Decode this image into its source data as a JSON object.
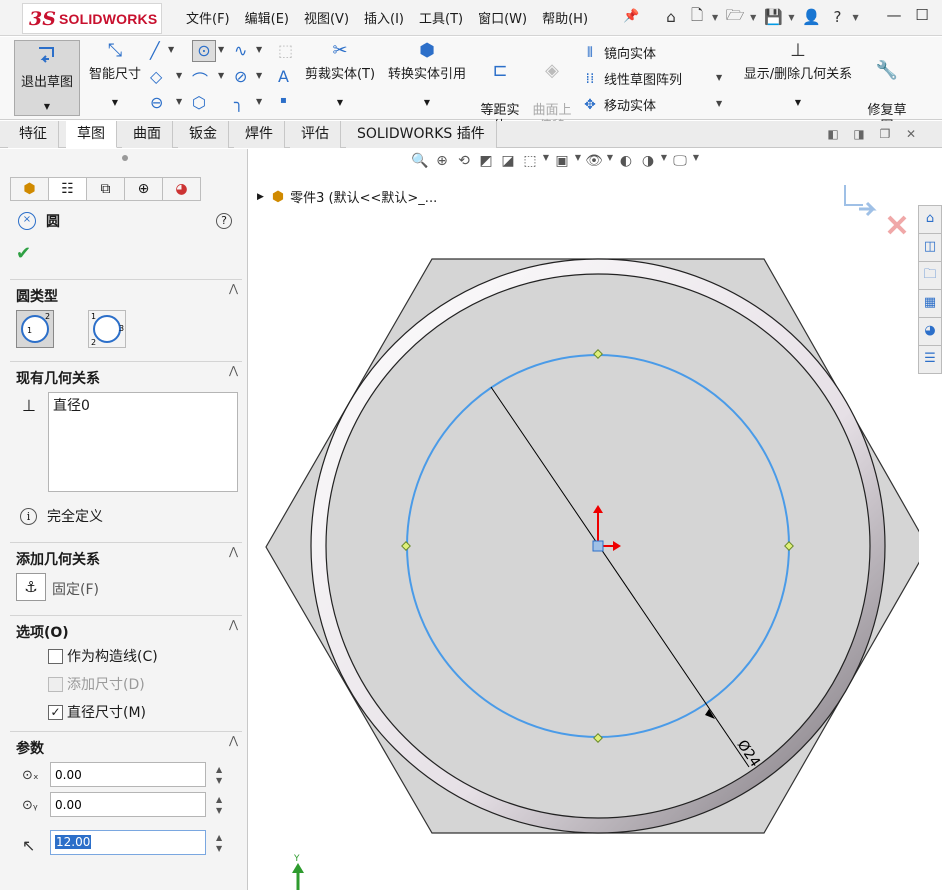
{
  "app": {
    "logo_ds": "3S",
    "logo_text": "SOLIDWORKS"
  },
  "menu": [
    "文件(F)",
    "编辑(E)",
    "视图(V)",
    "插入(I)",
    "工具(T)",
    "窗口(W)",
    "帮助(H)"
  ],
  "ribbon": {
    "exit_sketch": "退出草图",
    "smart_dimension": "智能尺寸",
    "trim": "剪裁实体(T)",
    "convert": "转换实体引用",
    "offset": "等距实\n体",
    "offset_surface": "曲面上\n偏移",
    "mirror": "镜向实体",
    "linear_pattern": "线性草图阵列",
    "move": "移动实体",
    "display_relations": "显示/删除几何关系",
    "repair": "修复草\n图"
  },
  "tabs": [
    "特征",
    "草图",
    "曲面",
    "钣金",
    "焊件",
    "评估",
    "SOLIDWORKS 插件"
  ],
  "active_tab": "草图",
  "property_manager": {
    "title": "圆",
    "circle_type_label": "圆类型",
    "existing_relations_label": "现有几何关系",
    "relation_item": "直径0",
    "fully_defined": "完全定义",
    "add_relations_label": "添加几何关系",
    "fix_label": "固定(F)",
    "options_label": "选项(O)",
    "construction": "作为构造线(C)",
    "add_dimension": "添加尺寸(D)",
    "diameter_dimension": "直径尺寸(M)",
    "parameters_label": "参数",
    "cx": "0.00",
    "cy": "0.00",
    "radius": "12.00"
  },
  "tree": {
    "part": "零件3  (默认<<默认>_..."
  },
  "sketch": {
    "dimension": "Ø24",
    "axis_y": "Y"
  },
  "colors": {
    "accent": "#2c6fc9",
    "sketch_blue": "#4a9be8",
    "brand": "#c8102e"
  }
}
